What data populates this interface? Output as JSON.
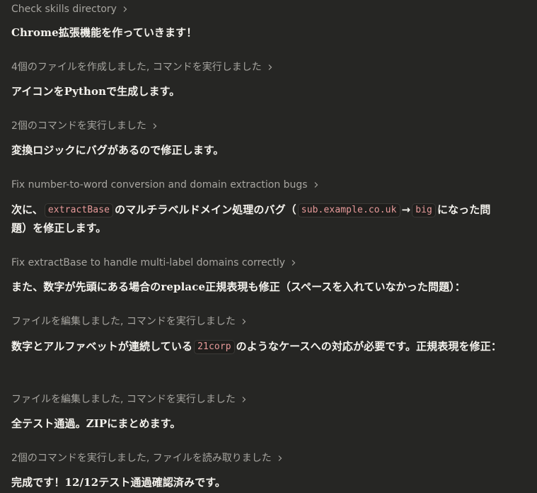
{
  "feed": {
    "steps": [
      {
        "label": "Check skills directory"
      },
      {
        "label": "4個のファイルを作成しました, コマンドを実行しました"
      },
      {
        "label": "2個のコマンドを実行しました"
      },
      {
        "label": "Fix number-to-word conversion and domain extraction bugs"
      },
      {
        "label": "Fix extractBase to handle multi-label domains correctly"
      },
      {
        "label": "ファイルを編集しました, コマンドを実行しました"
      },
      {
        "label": "ファイルを編集しました, コマンドを実行しました"
      },
      {
        "label": "2個のコマンドを実行しました, ファイルを読み取りました"
      }
    ],
    "messages": [
      {
        "text": "Chrome拡張機能を作っていきます！"
      },
      {
        "text": "アイコンをPythonで生成します。"
      },
      {
        "text": "変換ロジックにバグがあるので修正します。"
      },
      {
        "p1": "次に、",
        "code1": "extractBase",
        "p2": "のマルチラベルドメイン処理のバグ（",
        "code2": "sub.example.co.uk",
        "arrow": "→",
        "code3": "big",
        "p3": "になった問題）を修正します。"
      },
      {
        "text": "また、数字が先頭にある場合のreplace正規表現も修正（スペースを入れていなかった問題）："
      },
      {
        "p1": "数字とアルファベットが連続している",
        "code1": "21corp",
        "p2": "のようなケースへの対応が必要です。正規表現を修正："
      },
      {
        "text": "全テスト通過。ZIPにまとめます。"
      },
      {
        "text": "完成です！12/12テスト通過確認済みです。"
      }
    ]
  },
  "colors": {
    "background": "#262624",
    "step_text": "#a7a5a0",
    "message_text": "#f4f2ed",
    "code_text": "#e79a9a",
    "code_bg": "#1f1e1c",
    "code_border": "#3b3a37"
  },
  "icons": {
    "step_expand": "chevron-right-icon"
  }
}
